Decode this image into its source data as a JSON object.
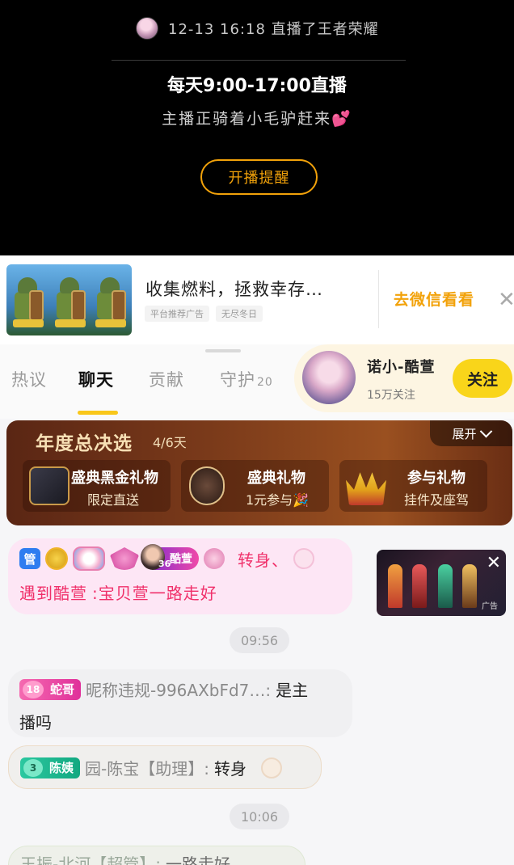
{
  "top": {
    "last_live": "12-13 16:18 直播了王者荣耀",
    "schedule": "每天9:00-17:00直播",
    "status": "主播正骑着小毛驴赶来💕",
    "remind_button": "开播提醒"
  },
  "ad": {
    "title": "收集燃料，拯救幸存…",
    "tags": [
      "平台推荐广告",
      "无尽冬日"
    ],
    "cta": "去微信看看",
    "close_icon": "✕"
  },
  "tabs": [
    {
      "label": "热议",
      "count": ""
    },
    {
      "label": "聊天",
      "count": ""
    },
    {
      "label": "贡献",
      "count": ""
    },
    {
      "label": "守护",
      "count": "20"
    }
  ],
  "active_tab": 1,
  "anchor": {
    "name": "诺小-酷萱",
    "fans": "15万关注",
    "follow_button": "关注"
  },
  "event": {
    "title": "年度总决选",
    "days": "4/6天",
    "expand": "展开",
    "items": [
      {
        "title": "盛典黑金礼物",
        "subtitle": "限定直送"
      },
      {
        "title": "盛典礼物",
        "subtitle": "1元参与🎉"
      },
      {
        "title": "参与礼物",
        "subtitle": "挂件及座驾"
      }
    ]
  },
  "messages": {
    "m1": {
      "badge_admin": "管",
      "fan_badge_level": "36",
      "fan_badge_name": "酷萱",
      "action": "转身、",
      "line2_name": "遇到酷萱",
      "line2_content": ":宝贝萱一路走好"
    },
    "time1": "09:56",
    "m2": {
      "level": "18",
      "badge": "蛇哥",
      "name": "昵称违规-996AXbFd7…:",
      "content_a": "是主",
      "content_b": "播吗"
    },
    "m3": {
      "level": "3",
      "badge": "陈姨",
      "name": "园-陈宝【助理】:",
      "content": "转身"
    },
    "time2": "10:06",
    "m4": {
      "name": "王振-北河【超管】:",
      "content": "一路走好"
    }
  },
  "video": {
    "label": "广告"
  },
  "colors": {
    "accent_yellow": "#f9c71a",
    "accent_orange": "#f2a20a",
    "chat_pink": "#f0306a"
  }
}
